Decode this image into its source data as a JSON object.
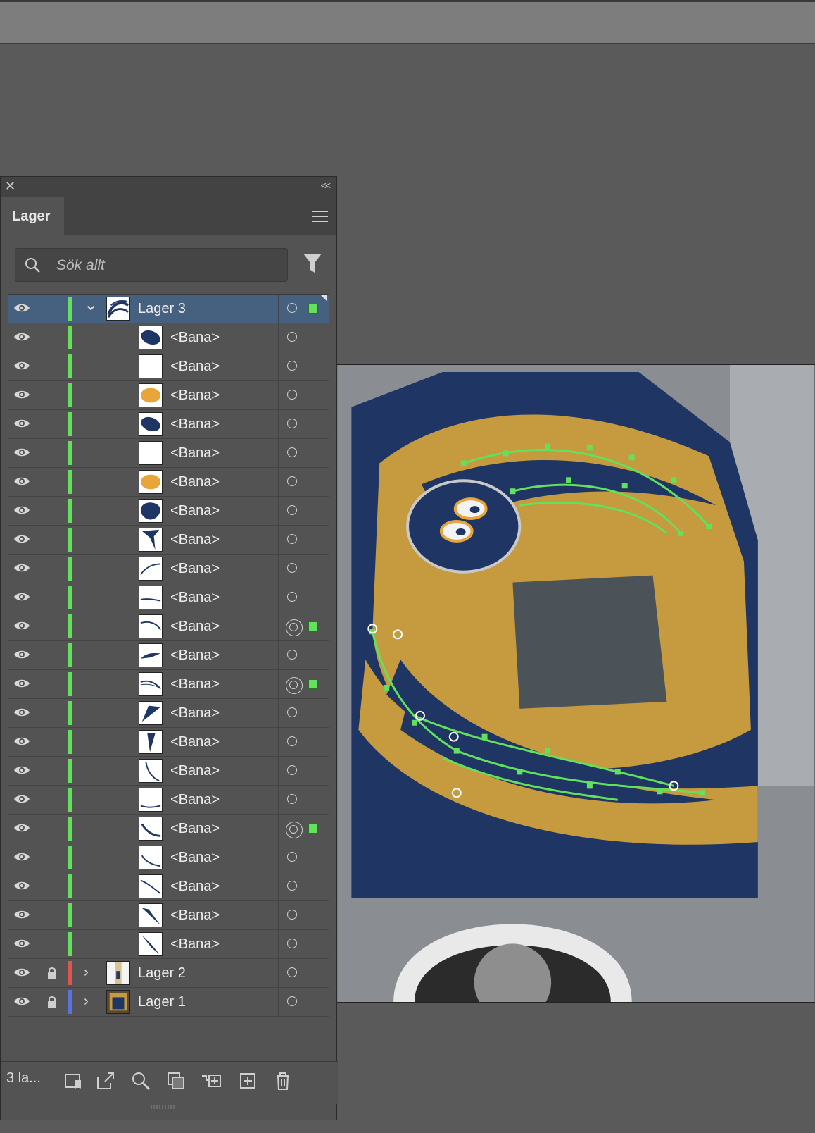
{
  "panel": {
    "title": "Lager",
    "close_icon": "close-icon",
    "collapse_icon": "<<",
    "search_placeholder": "Sök allt",
    "layer_count": "3 la..."
  },
  "layers": [
    {
      "name": "Lager 3",
      "type": "layer",
      "expanded": true,
      "selected": true,
      "color": "#63e05c",
      "thumb": "stripes",
      "target": "single",
      "selection": true
    },
    {
      "name": "<Bana>",
      "type": "path",
      "thumb": "navy-ellipse",
      "target": "single"
    },
    {
      "name": "<Bana>",
      "type": "path",
      "thumb": "blank",
      "target": "single"
    },
    {
      "name": "<Bana>",
      "type": "path",
      "thumb": "orange-ellipse",
      "target": "single"
    },
    {
      "name": "<Bana>",
      "type": "path",
      "thumb": "navy-ellipse",
      "target": "single"
    },
    {
      "name": "<Bana>",
      "type": "path",
      "thumb": "blank",
      "target": "single"
    },
    {
      "name": "<Bana>",
      "type": "path",
      "thumb": "orange-ellipse",
      "target": "single"
    },
    {
      "name": "<Bana>",
      "type": "path",
      "thumb": "navy-blob",
      "target": "single"
    },
    {
      "name": "<Bana>",
      "type": "path",
      "thumb": "navy-fang",
      "target": "single"
    },
    {
      "name": "<Bana>",
      "type": "path",
      "thumb": "curve-1",
      "target": "single"
    },
    {
      "name": "<Bana>",
      "type": "path",
      "thumb": "curve-2",
      "target": "single"
    },
    {
      "name": "<Bana>",
      "type": "path",
      "thumb": "curve-3",
      "target": "double",
      "selection": true
    },
    {
      "name": "<Bana>",
      "type": "path",
      "thumb": "curve-4",
      "target": "single"
    },
    {
      "name": "<Bana>",
      "type": "path",
      "thumb": "curve-5",
      "target": "double",
      "selection": true
    },
    {
      "name": "<Bana>",
      "type": "path",
      "thumb": "wedge-1",
      "target": "single"
    },
    {
      "name": "<Bana>",
      "type": "path",
      "thumb": "wedge-2",
      "target": "single"
    },
    {
      "name": "<Bana>",
      "type": "path",
      "thumb": "curve-6",
      "target": "single"
    },
    {
      "name": "<Bana>",
      "type": "path",
      "thumb": "curve-7",
      "target": "single"
    },
    {
      "name": "<Bana>",
      "type": "path",
      "thumb": "curve-8",
      "target": "double",
      "selection": true
    },
    {
      "name": "<Bana>",
      "type": "path",
      "thumb": "curve-9",
      "target": "single"
    },
    {
      "name": "<Bana>",
      "type": "path",
      "thumb": "curve-10",
      "target": "single"
    },
    {
      "name": "<Bana>",
      "type": "path",
      "thumb": "wedge-3",
      "target": "single"
    },
    {
      "name": "<Bana>",
      "type": "path",
      "thumb": "wedge-4",
      "target": "single"
    },
    {
      "name": "Lager 2",
      "type": "layer",
      "expanded": false,
      "locked": true,
      "color": "#e0554f",
      "thumb": "photo-light",
      "target": "single"
    },
    {
      "name": "Lager 1",
      "type": "layer",
      "expanded": false,
      "locked": true,
      "color": "#5a73e0",
      "thumb": "photo-dark",
      "target": "single"
    }
  ],
  "footer_icons": [
    "collect-for-export-icon",
    "export-icon",
    "locate-object-icon",
    "make-clipping-mask-icon",
    "create-sublayer-icon",
    "create-layer-icon",
    "trash-icon"
  ],
  "colors": {
    "navy": "#1f3563",
    "gold": "#c69a3e",
    "selection": "#63e05c",
    "selected_row": "#46607f"
  }
}
